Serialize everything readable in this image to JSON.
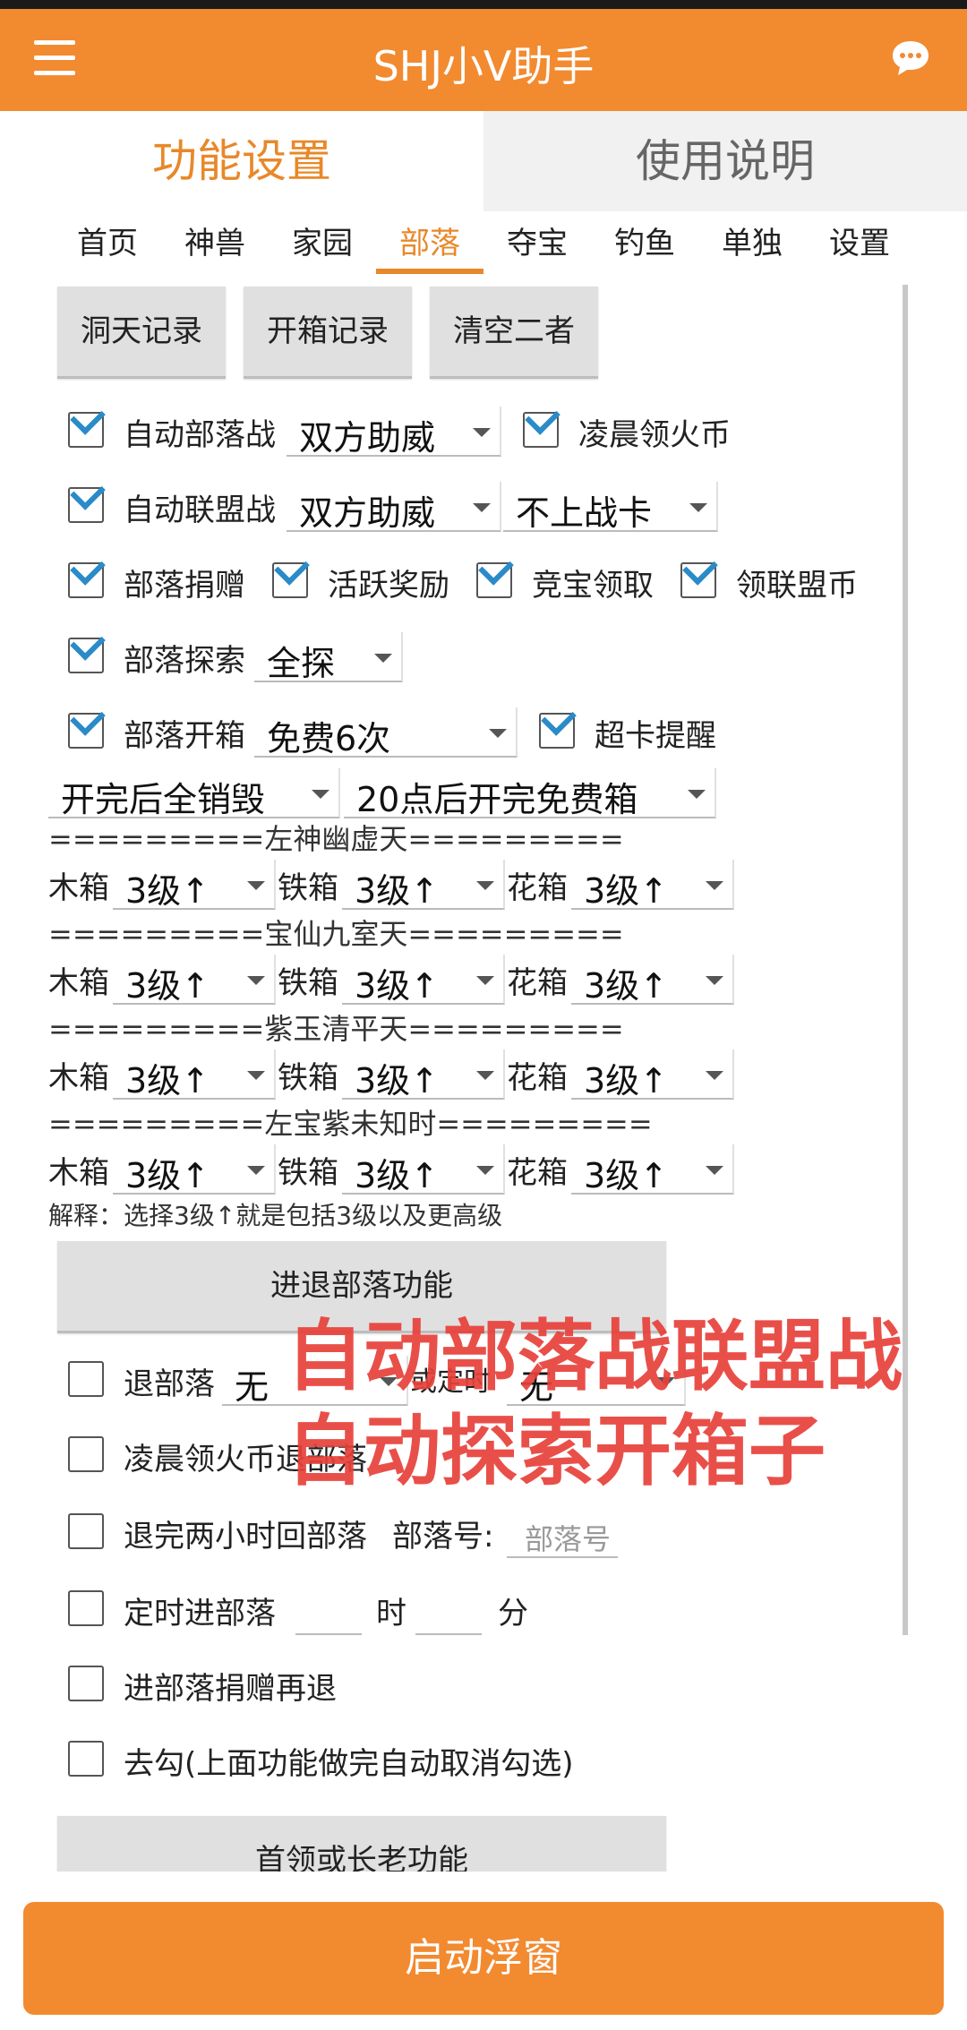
{
  "app": {
    "title": "SHJ小V助手"
  },
  "main_tabs": [
    {
      "label": "功能设置"
    },
    {
      "label": "使用说明"
    }
  ],
  "sub_tabs": [
    "首页",
    "神兽",
    "家园",
    "部落",
    "夺宝",
    "钓鱼",
    "单独",
    "设置"
  ],
  "buttons": {
    "b1": "洞天记录",
    "b2": "开箱记录",
    "b3": "清空二者"
  },
  "rows": {
    "auto_tribe_war": {
      "label": "自动部落战",
      "select": "双方助威",
      "checked": true
    },
    "morning_coin": {
      "label": "凌晨领火币",
      "checked": true
    },
    "auto_alliance_war": {
      "label": "自动联盟战",
      "select": "双方助威",
      "checked": true
    },
    "no_battle_card": {
      "select": "不上战卡"
    },
    "tribe_donate": {
      "label": "部落捐赠",
      "checked": true
    },
    "active_reward": {
      "label": "活跃奖励",
      "checked": true
    },
    "bid_collect": {
      "label": "竞宝领取",
      "checked": true
    },
    "alliance_coin": {
      "label": "领联盟币",
      "checked": true
    },
    "tribe_explore": {
      "label": "部落探索",
      "select": "全探",
      "checked": true
    },
    "tribe_box": {
      "label": "部落开箱",
      "select": "免费6次",
      "checked": true
    },
    "super_card": {
      "label": "超卡提醒",
      "checked": true
    },
    "after_open": {
      "select": "开完后全销毁"
    },
    "after_20": {
      "select": "20点后开完免费箱"
    }
  },
  "box_labels": {
    "wood": "木箱",
    "iron": "铁箱",
    "flower": "花箱"
  },
  "sections": [
    {
      "title": "=========左神幽虚天=========",
      "wood": "3级↑",
      "iron": "3级↑",
      "flower": "3级↑"
    },
    {
      "title": "=========宝仙九室天=========",
      "wood": "3级↑",
      "iron": "3级↑",
      "flower": "3级↑"
    },
    {
      "title": "=========紫玉清平天=========",
      "wood": "3级↑",
      "iron": "3级↑",
      "flower": "3级↑"
    },
    {
      "title": "=========左宝紫未知时=========",
      "wood": "3级↑",
      "iron": "3级↑",
      "flower": "3级↑"
    }
  ],
  "note": "解释：选择3级↑就是包括3级以及更高级",
  "tribe_in_out": {
    "header": "进退部落功能",
    "quit": {
      "label": "退部落",
      "select": "无",
      "or_label": "或定时",
      "select2": "无"
    },
    "morning_quit": {
      "label": "凌晨领火币退部落"
    },
    "return_two_hours": {
      "label": "退完两小时回部落",
      "id_label": "部落号:",
      "placeholder": "部落号"
    },
    "timed_enter": {
      "label": "定时进部落",
      "hour": "时",
      "minute": "分"
    },
    "enter_donate": {
      "label": "进部落捐赠再退"
    },
    "uncheck": {
      "label": "去勾(上面功能做完自动取消勾选)"
    }
  },
  "leader_header": "首领或长老功能",
  "overlay": {
    "line1": "自动部落战联盟战",
    "line2": "自动探索开箱子"
  },
  "start_button": "启动浮窗",
  "colors": {
    "accent": "#f28a30",
    "check": "#2a8bc8",
    "overlay": "#e8413a"
  }
}
